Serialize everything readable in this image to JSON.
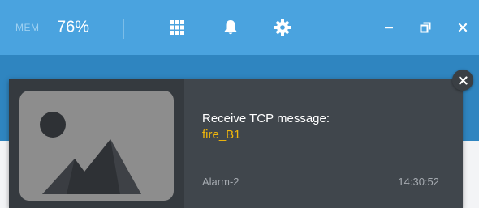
{
  "topbar": {
    "mem_label": "MEM",
    "mem_value": "76%",
    "icons": [
      "grid-icon",
      "bell-icon",
      "gear-icon"
    ],
    "window_controls": [
      "minimize-icon",
      "restore-icon",
      "close-icon"
    ]
  },
  "notification": {
    "title": "Receive TCP message:",
    "value": "fire_B1",
    "source": "Alarm-2",
    "time": "14:30:52",
    "thumbnail_icon": "image-placeholder-icon",
    "close_icon": "close-icon"
  },
  "colors": {
    "topbar": "#4aa3df",
    "band": "#2f85c0",
    "card": "#40464c",
    "accent_value": "#f2b70b"
  }
}
